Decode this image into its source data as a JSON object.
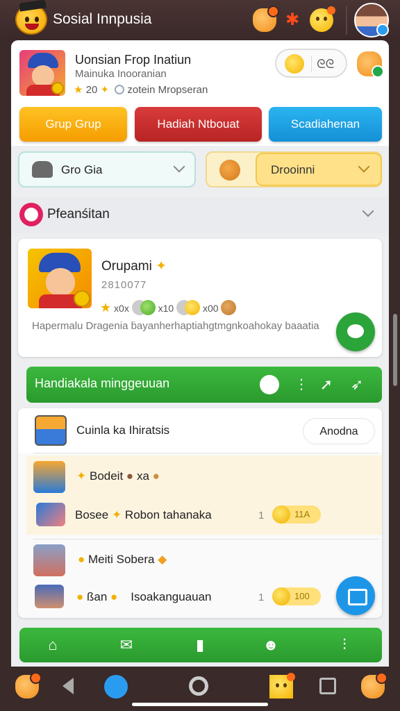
{
  "app": {
    "title": "Sosial Innpusia"
  },
  "profile": {
    "name": "Uonsian Frop Inatiun",
    "subtitle": "Mainuka Inooranian",
    "stats": "20",
    "stats_extra": "zotein Mropseran",
    "toggle_text": "ᘓᘓ"
  },
  "actions": {
    "grup": "Grup Grup",
    "hadiah": "Hadiah Ntbouat",
    "scad": "Scadiahenan"
  },
  "filters": {
    "left": "Gro Gia",
    "right": "Drooinni"
  },
  "section": {
    "title": "Pfeanśitan"
  },
  "feature": {
    "title": "Orupami",
    "number": "2810077",
    "stat1": "x0x",
    "stat2": "x10",
    "stat3": "x00",
    "description": "Hapermalu Dragenia ḃayanherhaptiahgtmgnkoahokay baaatia"
  },
  "weekly": {
    "title": "Handiakala minggeuuan"
  },
  "list": {
    "title": "Cuinla ka Ihiratsis",
    "pill": "Anodna",
    "rows": [
      {
        "text": "Bodeit",
        "extra": "xa"
      },
      {
        "text": "Bosee",
        "extra": "Robon tahanaka",
        "count": "1",
        "coins": "11A"
      },
      {
        "text": "Meiti Sobera"
      },
      {
        "text": "ßan",
        "extra": "Isoakanguauan",
        "count": "1",
        "coins": "100"
      }
    ]
  },
  "colors": {
    "green": "#2a9a2e",
    "orange": "#f59d00",
    "red": "#b82424",
    "blue": "#1590d6",
    "topbar": "#3a2828"
  }
}
